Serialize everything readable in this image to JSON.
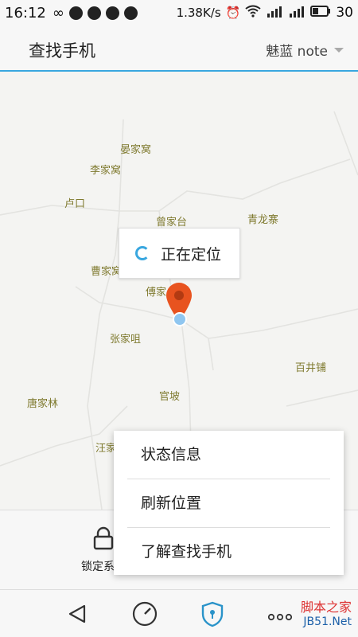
{
  "status_bar": {
    "time": "16:12",
    "net_speed": "1.38K/s",
    "battery": "30"
  },
  "app_bar": {
    "title": "查找手机",
    "device": "魅蓝 note"
  },
  "map": {
    "places": [
      "晏家窝",
      "李家窝",
      "卢口",
      "曾家台",
      "青龙寨",
      "曹家窝",
      "傅家",
      "张家咀",
      "百井铺",
      "唐家林",
      "官坡",
      "汪家"
    ],
    "locating_text": "正在定位"
  },
  "bottom_action": {
    "label": "锁定系统"
  },
  "menu": {
    "items": [
      "状态信息",
      "刷新位置",
      "了解查找手机"
    ]
  },
  "watermark": {
    "line1": "脚本之家",
    "line2": "JB51.Net"
  },
  "colors": {
    "accent": "#39a7df",
    "pin": "#e8531f",
    "place_text": "#7f7a2f"
  }
}
